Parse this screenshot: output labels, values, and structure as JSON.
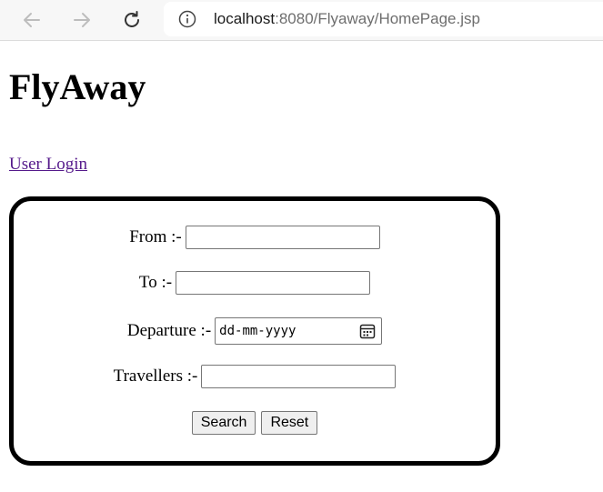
{
  "browser": {
    "url_host": "localhost",
    "url_rest": ":8080/Flyaway/HomePage.jsp",
    "icons": [
      "back-arrow-icon",
      "forward-arrow-icon",
      "reload-icon",
      "info-icon"
    ]
  },
  "page": {
    "title": "FlyAway",
    "login_link": "User Login"
  },
  "form": {
    "from_label": "From :-",
    "from_value": "",
    "to_label": "To :-",
    "to_value": "",
    "departure_label": "Departure :-",
    "departure_placeholder": "dd-mm-yyyy",
    "travellers_label": "Travellers :-",
    "travellers_value": "",
    "search_label": "Search",
    "reset_label": "Reset"
  }
}
